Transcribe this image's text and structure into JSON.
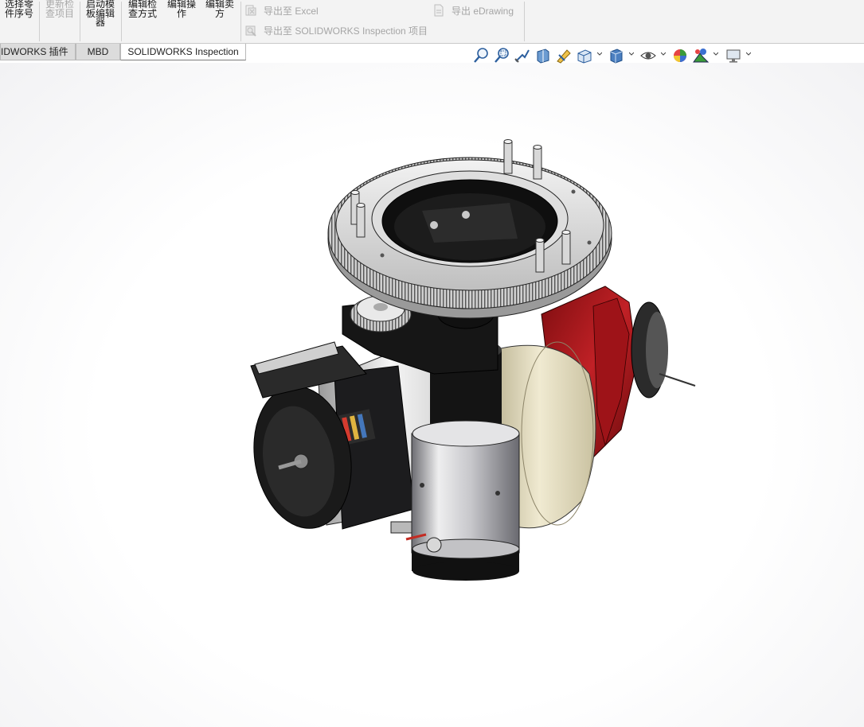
{
  "ribbon": {
    "buttons": [
      {
        "label": "选择零\n件序号",
        "enabled": true
      },
      {
        "label": "更新检\n查项目",
        "enabled": false
      },
      {
        "label": "启动模\n板编辑\n器",
        "enabled": true
      },
      {
        "label": "编辑检\n查方式",
        "enabled": true
      },
      {
        "label": "编辑操\n作",
        "enabled": true
      },
      {
        "label": "编辑卖\n方",
        "enabled": true
      }
    ],
    "export_excel": "导出至 Excel",
    "export_inspection": "导出至 SOLIDWORKS Inspection 项目",
    "export_edrawing": "导出 eDrawing"
  },
  "tabs": [
    {
      "label": "IDWORKS 插件",
      "active": false
    },
    {
      "label": "MBD",
      "active": false
    },
    {
      "label": "SOLIDWORKS Inspection",
      "active": true
    }
  ],
  "heads_up_toolbar": [
    "zoom-to-fit-icon",
    "zoom-to-area-icon",
    "previous-view-icon",
    "section-view-icon",
    "dynamic-annotation-icon",
    "view-orientation-icon",
    "display-style-icon",
    "hide-show-items-icon",
    "edit-appearance-icon",
    "apply-scene-icon",
    "view-settings-icon"
  ],
  "colors": {
    "accent_red": "#a3161a",
    "ring_silver": "#dcdcdc",
    "tire_cream": "#ded6b6"
  }
}
